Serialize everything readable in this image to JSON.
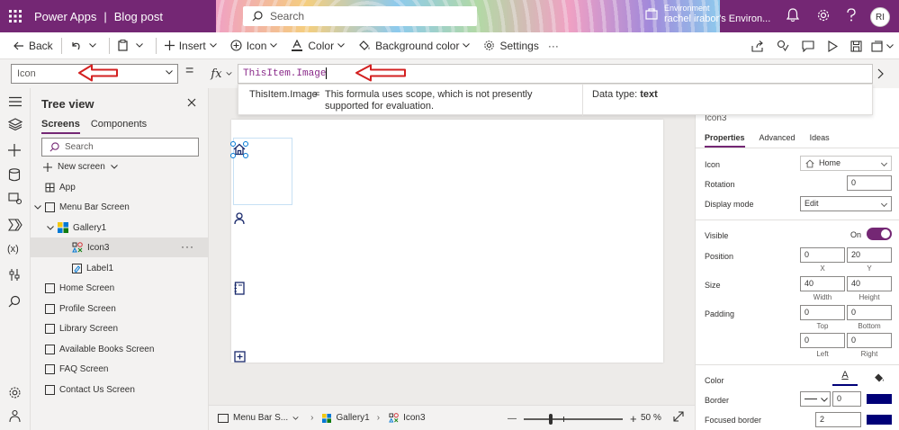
{
  "header": {
    "app_name": "Power Apps",
    "separator": "|",
    "doc_name": "Blog post",
    "search_placeholder": "Search",
    "env_label": "Environment",
    "env_value": "rachel irabor's Environ...",
    "avatar_initials": "RI"
  },
  "cmdbar": {
    "back": "Back",
    "insert": "Insert",
    "icon": "Icon",
    "color": "Color",
    "background_color": "Background color",
    "settings": "Settings",
    "more": "···"
  },
  "formula": {
    "property": "Icon",
    "equals": "=",
    "fx": "fx",
    "expression": "ThisItem.Image"
  },
  "hint": {
    "expression": "ThisItem.Image",
    "equals": "=",
    "message": "This formula uses scope, which is not presently supported for evaluation.",
    "datatype_label": "Data type:",
    "datatype_value": "text"
  },
  "tree": {
    "title": "Tree view",
    "tabs": [
      "Screens",
      "Components"
    ],
    "search_placeholder": "Search",
    "new_screen": "New screen",
    "nodes": {
      "app": "App",
      "menu_bar_screen": "Menu Bar Screen",
      "gallery1": "Gallery1",
      "icon3": "Icon3",
      "label1": "Label1",
      "home_screen": "Home Screen",
      "profile_screen": "Profile Screen",
      "library_screen": "Library Screen",
      "available_books_screen": "Available Books Screen",
      "faq_screen": "FAQ Screen",
      "contact_us_screen": "Contact Us Screen"
    },
    "more": "···"
  },
  "status": {
    "screen": "Menu Bar S...",
    "gallery": "Gallery1",
    "icon": "Icon3",
    "zoom_minus": "—",
    "zoom_plus": "+",
    "zoom_value": "50",
    "zoom_unit": "%",
    "zoom_level": 50
  },
  "props": {
    "control_name": "Icon3",
    "tabs": [
      "Properties",
      "Advanced",
      "Ideas"
    ],
    "icon_label": "Icon",
    "icon_value": "Home",
    "rotation_label": "Rotation",
    "rotation_value": "0",
    "display_mode_label": "Display mode",
    "display_mode_value": "Edit",
    "visible_label": "Visible",
    "visible_value": "On",
    "position_label": "Position",
    "position_x": "0",
    "position_y": "20",
    "x_label": "X",
    "y_label": "Y",
    "size_label": "Size",
    "width_value": "40",
    "height_value": "40",
    "width_label": "Width",
    "height_label": "Height",
    "padding_label": "Padding",
    "padding_top": "0",
    "padding_bottom": "0",
    "padding_left": "0",
    "padding_right": "0",
    "top_label": "Top",
    "bottom_label": "Bottom",
    "left_label": "Left",
    "right_label": "Right",
    "color_label": "Color",
    "color_glyph": "A",
    "border_label": "Border",
    "border_value": "0",
    "focused_border_label": "Focused border",
    "focused_border_value": "2",
    "accent_color": "#742774",
    "swatch_color": "#000078"
  }
}
